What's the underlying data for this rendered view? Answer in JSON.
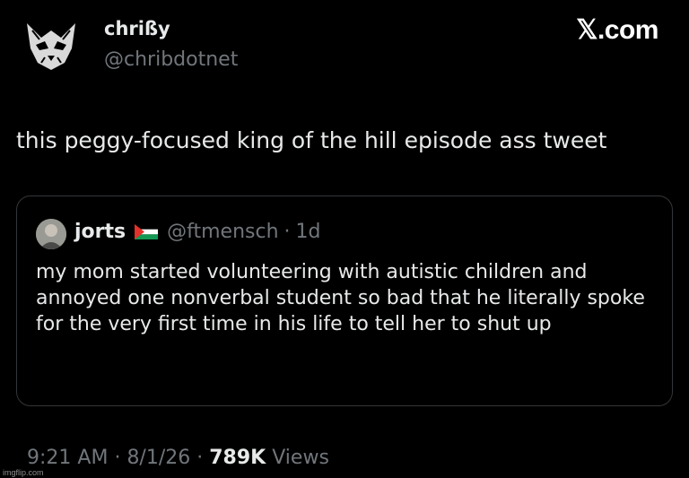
{
  "author": {
    "display_name": "chrißy",
    "handle": "@chribdotnet"
  },
  "brand": {
    "label": "𝕏.com"
  },
  "tweet": {
    "text": "this peggy-focused king of the hill episode ass tweet"
  },
  "quote": {
    "name": "jorts",
    "flag_icon": "palestine-flag-icon",
    "handle": "@ftmensch",
    "separator": "·",
    "age": "1d",
    "text": "my mom started volunteering with autistic children and annoyed one nonverbal student so bad that he literally spoke for the very first time in his life to tell her to shut up"
  },
  "meta": {
    "time": "9:21 AM",
    "date": "8/1/26",
    "separator": "·",
    "views_count": "789K",
    "views_label": "Views"
  },
  "watermark": "imgflip.com",
  "colors": {
    "background": "#000000",
    "text": "#e7e9ea",
    "muted": "#71767b",
    "border": "#333639"
  }
}
